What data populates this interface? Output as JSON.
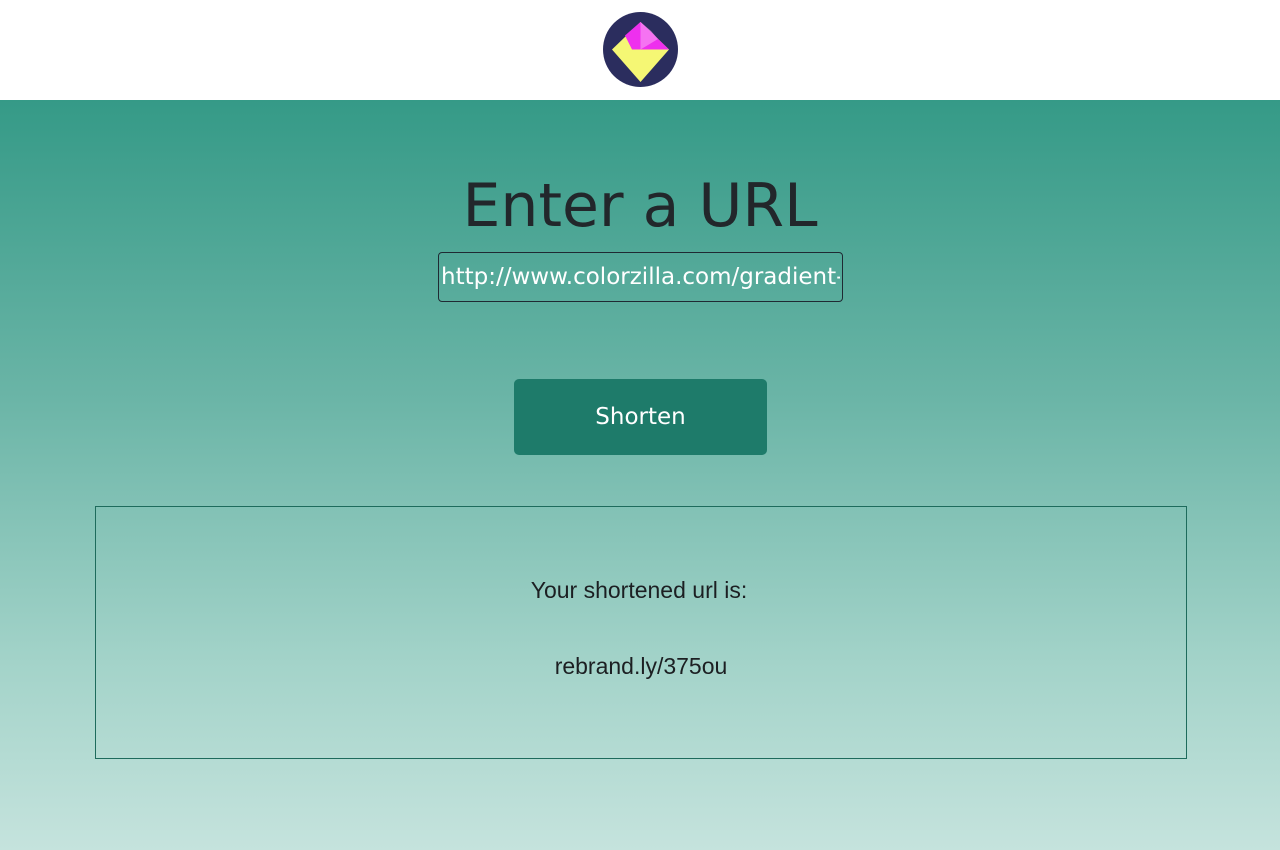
{
  "header": {
    "logo_icon": "diamond-logo-icon",
    "colors": {
      "logo_circle": "#2b2d5e",
      "logo_yellow": "#f5f774",
      "logo_magenta": "#ee30ee"
    }
  },
  "main": {
    "title": "Enter a URL",
    "url_input": {
      "value": "http://www.colorzilla.com/gradient-e",
      "placeholder": ""
    },
    "shorten_label": "Shorten",
    "result": {
      "label": "Your shortened url is:",
      "short_url": "rebrand.ly/375ou"
    },
    "colors": {
      "gradient_top": "#359a87",
      "gradient_bottom": "#c5e3dd",
      "button": "#1e7b6a",
      "title_text": "#22272b"
    }
  }
}
